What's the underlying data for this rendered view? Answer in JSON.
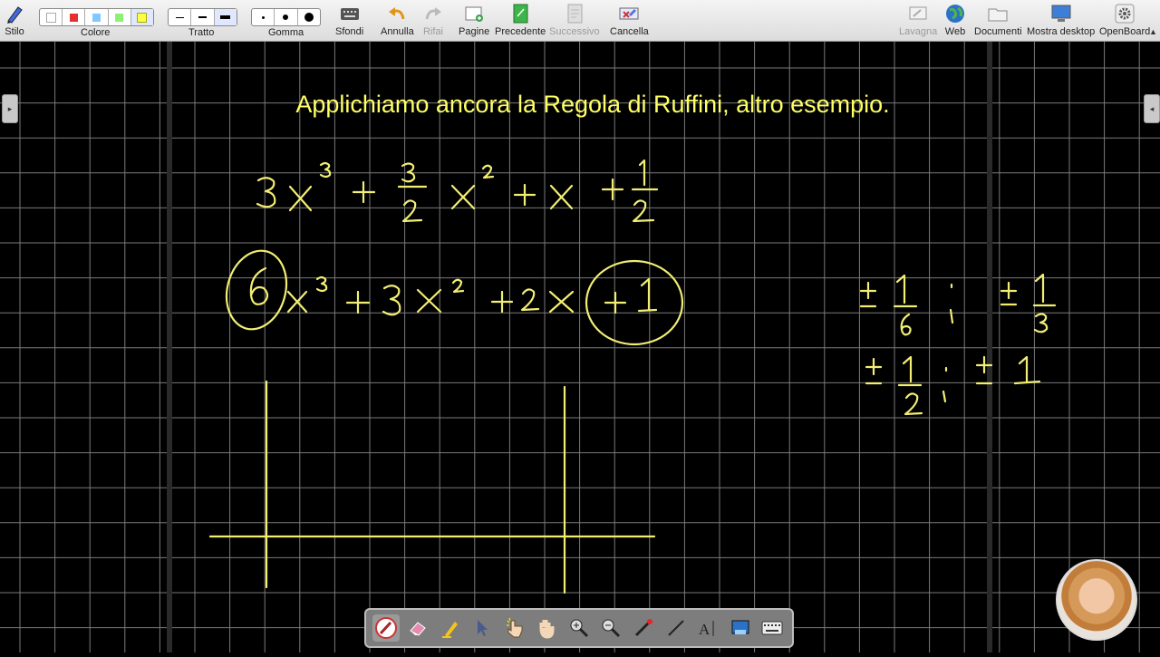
{
  "toolbar": {
    "left_items": [
      {
        "label": "Stilo",
        "icon": "pen-icon"
      },
      {
        "label": "Colore"
      },
      {
        "label": "Tratto"
      },
      {
        "label": "Gomma"
      },
      {
        "label": "Sfondi",
        "icon": "keyboard-grid-icon"
      },
      {
        "label": "Annulla",
        "icon": "undo-icon"
      },
      {
        "label": "Rifai",
        "icon": "redo-icon"
      },
      {
        "label": "Pagine",
        "icon": "add-page-icon"
      },
      {
        "label": "Precedente",
        "icon": "previous-page-icon"
      },
      {
        "label": "Successivo",
        "icon": "next-page-icon"
      },
      {
        "label": "Cancella",
        "icon": "clear-page-icon"
      }
    ],
    "right_items": [
      {
        "label": "Lavagna",
        "icon": "board-icon"
      },
      {
        "label": "Web",
        "icon": "globe-icon"
      },
      {
        "label": "Documenti",
        "icon": "folder-icon"
      },
      {
        "label": "Mostra desktop",
        "icon": "monitor-icon"
      },
      {
        "label": "OpenBoard",
        "icon": "settings-icon"
      }
    ],
    "colors": [
      "#ffffff",
      "#e53030",
      "#80c8ff",
      "#90f070",
      "#ffff40"
    ],
    "selected_color": "#ffff40"
  },
  "board": {
    "title": "Applichiamo ancora la Regola di Ruffini, altro esempio.",
    "ink_color": "#f2ee74",
    "title_color": "#ffff66",
    "grid_color": "#7a7a7a"
  },
  "dock": {
    "tools": [
      "pen-tool-icon",
      "eraser-tool-icon",
      "marker-tool-icon",
      "selector-tool-icon",
      "interactor-tool-icon",
      "hand-tool-icon",
      "zoom-in-tool-icon",
      "zoom-out-tool-icon",
      "laser-pointer-icon",
      "line-tool-icon",
      "text-tool-icon",
      "capture-tool-icon",
      "virtual-keyboard-icon"
    ],
    "active_tool": "pen-tool-icon"
  }
}
